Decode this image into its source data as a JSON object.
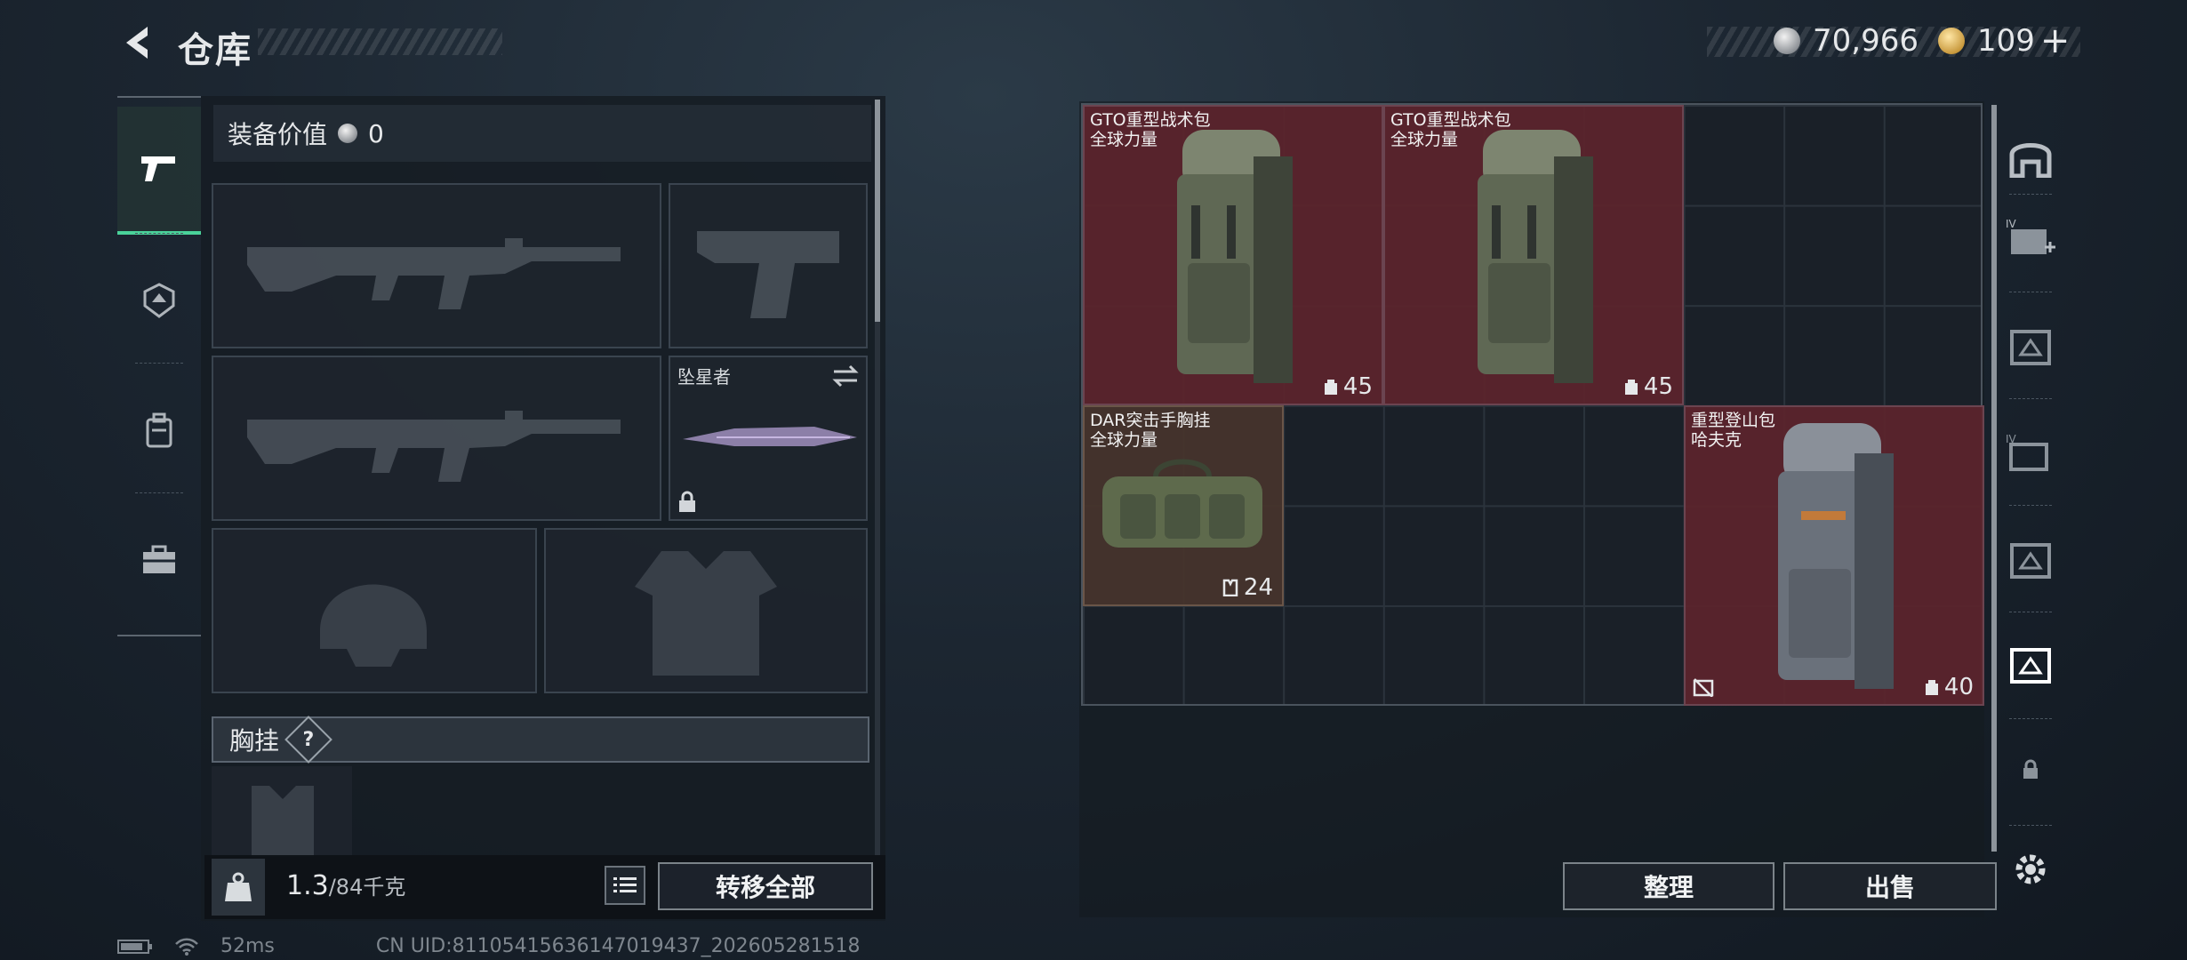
{
  "header": {
    "title": "仓库"
  },
  "currency": {
    "silver": "70,966",
    "gold": "109",
    "plus": "+"
  },
  "loadout": {
    "value_label": "装备价值",
    "value": "0",
    "melee_name": "坠星者",
    "section_title": "胸挂",
    "section_help": "?",
    "weight_value": "1.3",
    "weight_capacity": "/84千克",
    "transfer_all": "转移全部"
  },
  "stash": {
    "items": [
      {
        "name": "GTO重型战术包",
        "brand": "全球力量",
        "capacity": "45",
        "icon": "backpack-icon"
      },
      {
        "name": "GTO重型战术包",
        "brand": "全球力量",
        "capacity": "45",
        "icon": "backpack-icon"
      },
      {
        "name": "DAR突击手胸挂",
        "brand": "全球力量",
        "capacity": "24",
        "icon": "chest-rig-icon"
      },
      {
        "name": "重型登山包",
        "brand": "哈夫克",
        "capacity": "40",
        "icon": "backpack-icon"
      }
    ],
    "sort": "整理",
    "sell": "出售"
  },
  "status": {
    "ping": "52ms",
    "uid": "CN UID:81105415636147019437_202605281518"
  }
}
